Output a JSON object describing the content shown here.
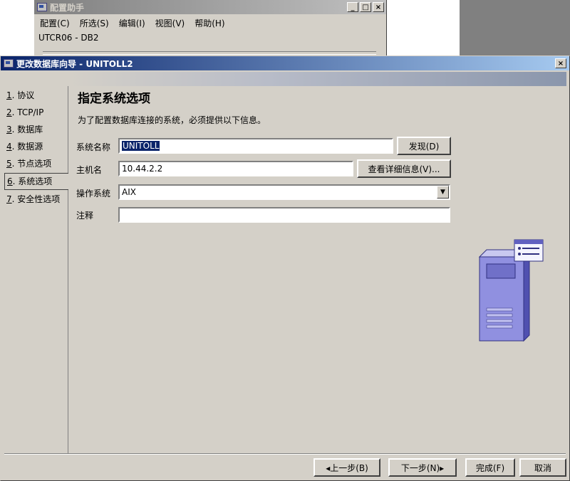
{
  "bg_window": {
    "title": "配置助手",
    "menu": [
      "配置(C)",
      "所选(S)",
      "编辑(I)",
      "视图(V)",
      "帮助(H)"
    ],
    "status": "UTCR06 - DB2"
  },
  "dialog": {
    "title": "更改数据库向导 - UNITOLL2",
    "close_label": "×"
  },
  "nav": {
    "items": [
      {
        "num": "1",
        "label": ". 协议"
      },
      {
        "num": "2",
        "label": ". TCP/IP"
      },
      {
        "num": "3",
        "label": ". 数据库"
      },
      {
        "num": "4",
        "label": ". 数据源"
      },
      {
        "num": "5",
        "label": ". 节点选项"
      },
      {
        "num": "6",
        "label": ". 系统选项"
      },
      {
        "num": "7",
        "label": ". 安全性选项"
      }
    ]
  },
  "page": {
    "heading": "指定系统选项",
    "description": "为了配置数据库连接的系统，必须提供以下信息。"
  },
  "form": {
    "system_name_label": "系统名称",
    "system_name_value": "UNITOLL",
    "discover_button": "发现(D)",
    "host_name_label": "主机名",
    "host_name_value": "10.44.2.2",
    "details_button": "查看详细信息(V)...",
    "os_label": "操作系统",
    "os_value": "AIX",
    "comment_label": "注释",
    "comment_value": ""
  },
  "footer": {
    "back": "◂上一步(B)",
    "next": "下一步(N)▸",
    "finish": "完成(F)",
    "cancel": "取消"
  }
}
